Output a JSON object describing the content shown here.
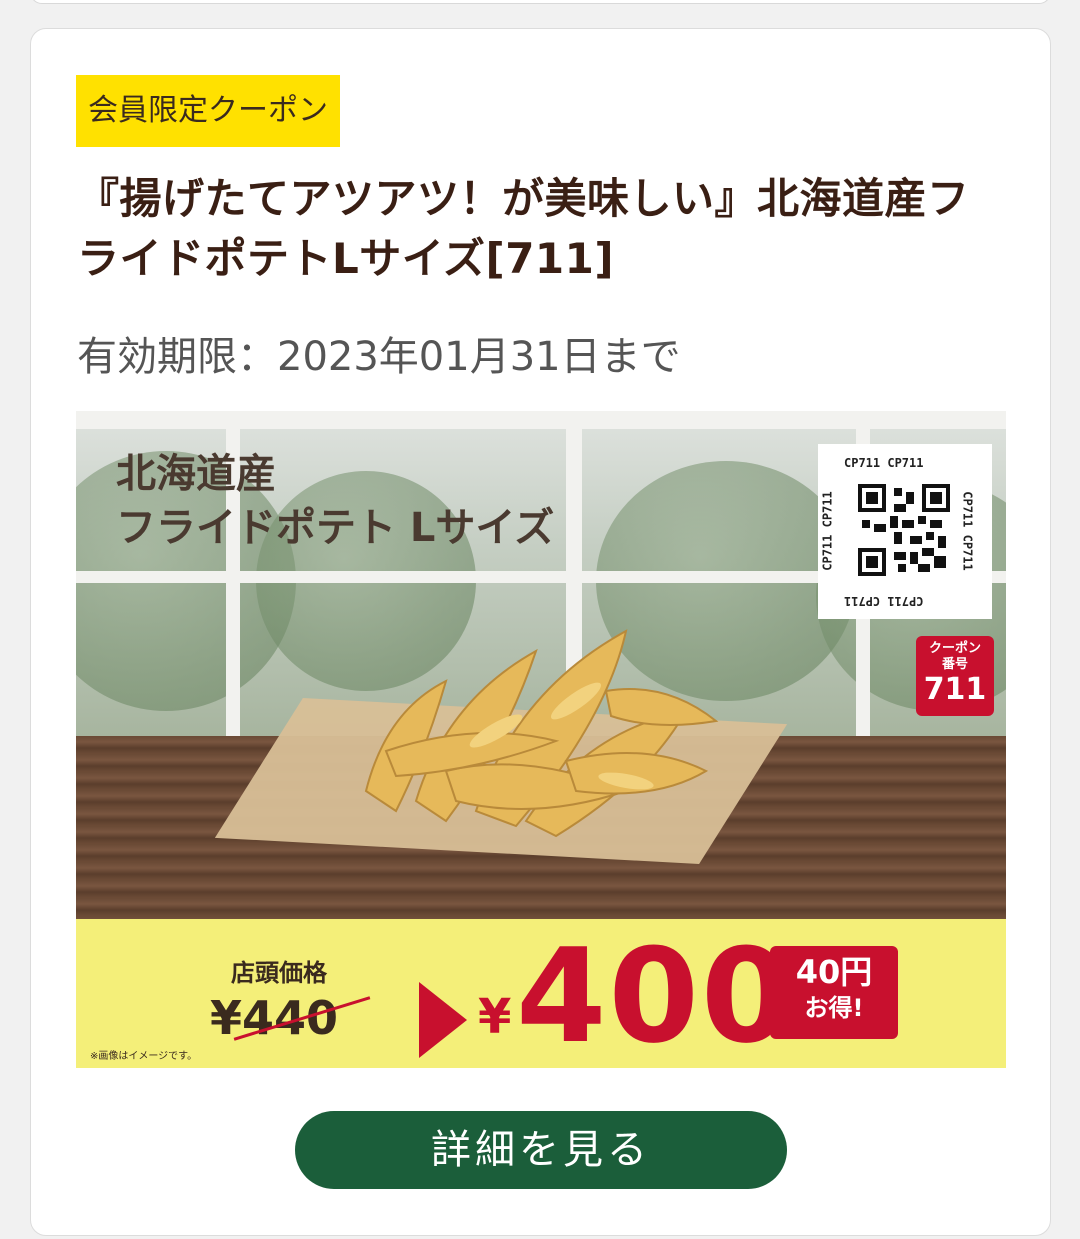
{
  "coupon": {
    "badge": "会員限定クーポン",
    "title": "『揚げたてアツアツ！が美味しい』北海道産フライドポテトLサイズ[711]",
    "expiry": "有効期限：2023年01月31日まで"
  },
  "banner": {
    "headline_line1": "北海道産",
    "headline_line2": "フライドポテト Lサイズ",
    "qr_label": "CP711 CP711",
    "coupon_tag_line1": "クーポン",
    "coupon_tag_line2": "番号",
    "coupon_tag_number": "711",
    "store_price_label": "店頭価格",
    "old_price": "¥440",
    "yen_symbol": "¥",
    "new_price": "400",
    "savings_amount": "40円",
    "savings_text": "お得!",
    "image_note": "※画像はイメージです。"
  },
  "actions": {
    "details_button": "詳細を見る"
  },
  "colors": {
    "badge_yellow": "#ffe100",
    "price_red": "#c8102e",
    "button_green": "#1b5e3a",
    "price_band_yellow": "#f4ef79"
  }
}
